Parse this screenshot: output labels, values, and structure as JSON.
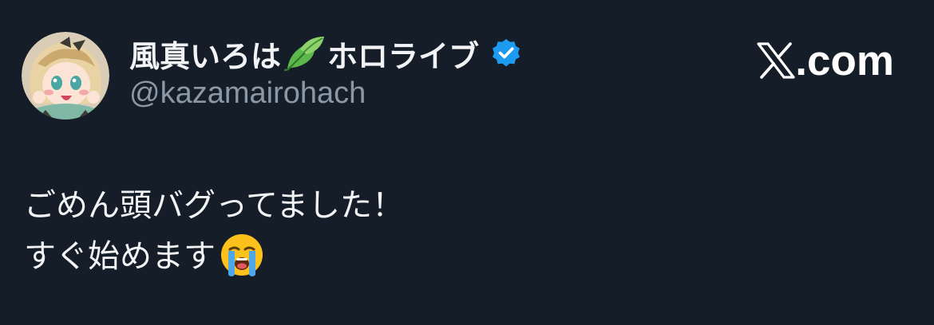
{
  "post": {
    "author": {
      "name": "風真いろは",
      "name_emoji": "leaf-icon",
      "org": "ホロライブ",
      "verified": true,
      "handle": "@kazamairohach",
      "verified_color": "#1d9bf0"
    },
    "brand": {
      "logo_icon": "x-logo-icon",
      "domain_suffix": ".com"
    },
    "text": {
      "line1": "ごめん頭バグってました！",
      "line2": "すぐ始めます",
      "line2_emoji": "loudly-crying-face-emoji"
    }
  },
  "colors": {
    "background": "#151d28",
    "text_primary": "#f1f3f5",
    "text_secondary": "#8b98a5"
  }
}
